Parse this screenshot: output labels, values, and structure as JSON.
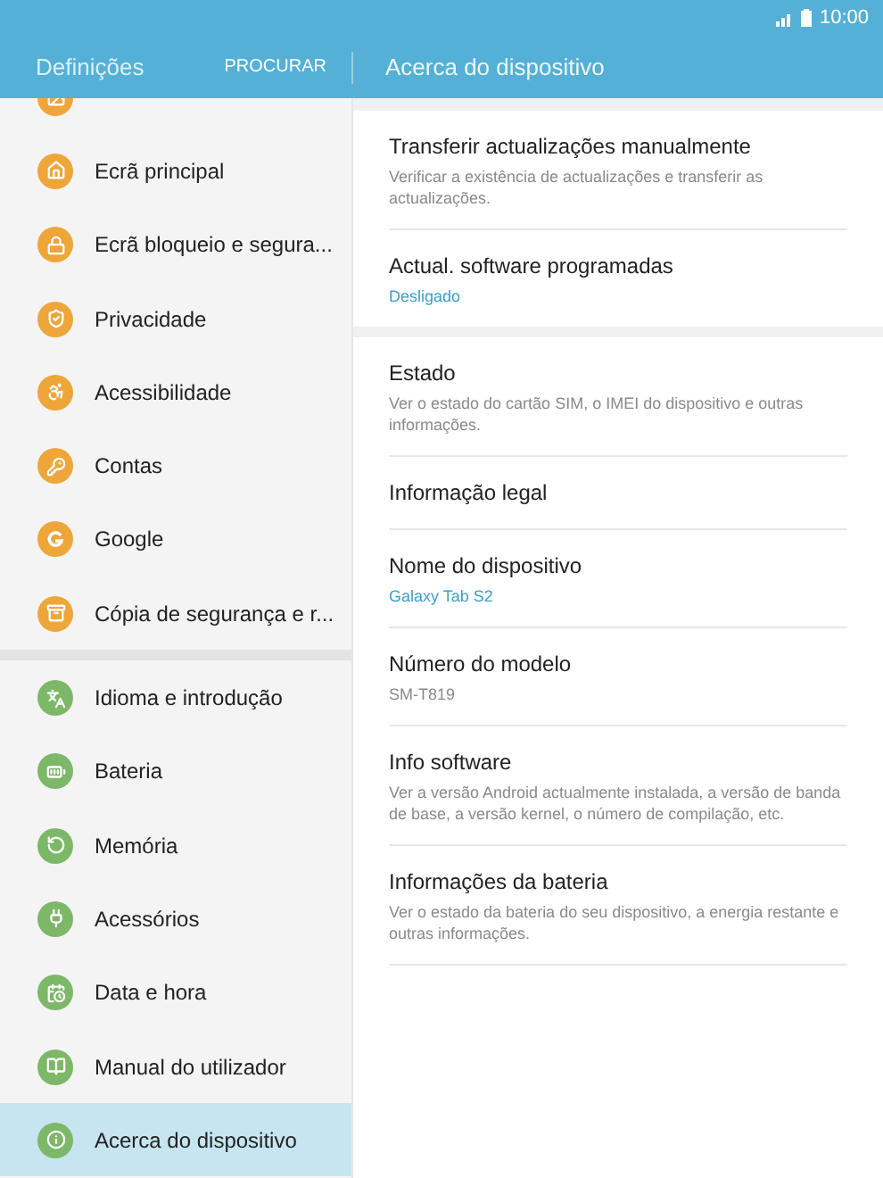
{
  "status_bar": {
    "time": "10:00"
  },
  "header": {
    "title": "Definições",
    "search": "PROCURAR",
    "detail_title": "Acerca do dispositivo"
  },
  "sidebar": {
    "groups": [
      {
        "items": [
          {
            "color": "#eea63a",
            "selected": false
          },
          {
            "label": "Ecrã principal",
            "color": "#eea63a",
            "selected": false
          },
          {
            "label": "Ecrã bloqueio e segura...",
            "color": "#eea63a",
            "selected": false
          },
          {
            "label": "Privacidade",
            "color": "#eea63a",
            "selected": false
          },
          {
            "label": "Acessibilidade",
            "color": "#eea63a",
            "selected": false
          },
          {
            "label": "Contas",
            "color": "#eea63a",
            "selected": false
          },
          {
            "label": "Google",
            "color": "#eea63a",
            "selected": false
          },
          {
            "label": "Cópia de segurança e r...",
            "color": "#eea63a",
            "selected": false
          }
        ]
      },
      {
        "items": [
          {
            "label": "Idioma e introdução",
            "color": "#7cb867",
            "selected": false
          },
          {
            "label": "Bateria",
            "color": "#7cb867",
            "selected": false
          },
          {
            "label": "Memória",
            "color": "#7cb867",
            "selected": false
          },
          {
            "label": "Acessórios",
            "color": "#7cb867",
            "selected": false
          },
          {
            "label": "Data e hora",
            "color": "#7cb867",
            "selected": false
          },
          {
            "label": "Manual do utilizador",
            "color": "#7cb867",
            "selected": false
          },
          {
            "label": "Acerca do dispositivo",
            "color": "#7cb867",
            "selected": true
          }
        ]
      }
    ]
  },
  "detail": {
    "sections": [
      {
        "items": [
          {
            "title": "Transferir actualizações manualmente",
            "summary": "Verificar a existência de actualizações e transferir as actualizações.",
            "accent": false
          },
          {
            "title": "Actual. software programadas",
            "summary": "Desligado",
            "accent": true
          }
        ]
      },
      {
        "items": [
          {
            "title": "Estado",
            "summary": "Ver o estado do cartão SIM, o IMEI do dispositivo e outras informações.",
            "accent": false
          },
          {
            "title": "Informação legal"
          },
          {
            "title": "Nome do dispositivo",
            "summary": "Galaxy Tab S2",
            "accent": true
          },
          {
            "title": "Número do modelo",
            "summary": "SM-T819",
            "accent": false
          },
          {
            "title": "Info software",
            "summary": "Ver a versão Android actualmente instalada, a versão de banda de base, a versão kernel, o número de compilação, etc.",
            "accent": false
          },
          {
            "title": "Informações da bateria",
            "summary": "Ver o estado da bateria do seu dispositivo, a energia restante e outras informações.",
            "accent": false
          }
        ]
      }
    ]
  }
}
